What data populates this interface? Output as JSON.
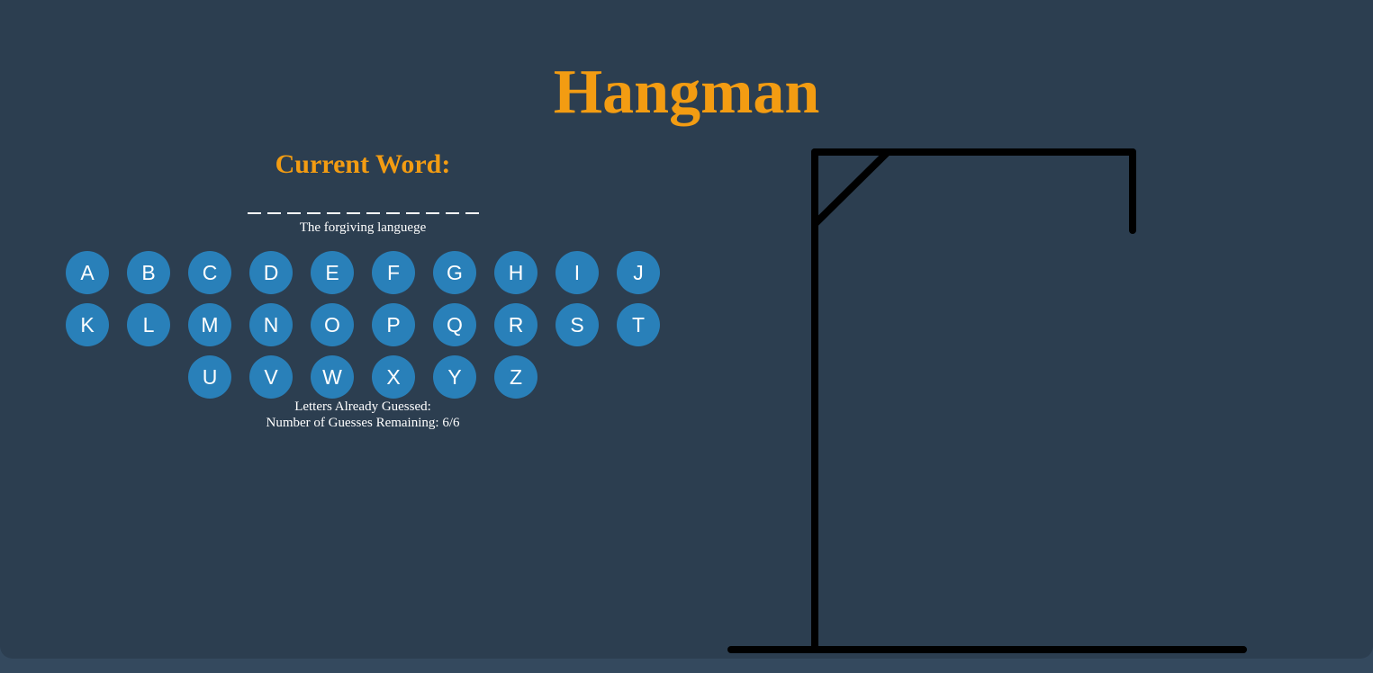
{
  "title": "Hangman",
  "current_word_label": "Current Word:",
  "word_blanks": [
    "_",
    "_",
    "_",
    "_",
    "_",
    "_",
    "_",
    "_",
    "_",
    "_",
    "_",
    "_"
  ],
  "hint": "The forgiving languege",
  "letters": [
    "A",
    "B",
    "C",
    "D",
    "E",
    "F",
    "G",
    "H",
    "I",
    "J",
    "K",
    "L",
    "M",
    "N",
    "O",
    "P",
    "Q",
    "R",
    "S",
    "T",
    "U",
    "V",
    "W",
    "X",
    "Y",
    "Z"
  ],
  "letters_guessed_label": "Letters Already Guessed:",
  "guesses_remaining_label": "Number of Guesses Remaining: 6/6",
  "colors": {
    "accent": "#f39c12",
    "background": "#2c3e50",
    "button": "#2980b9",
    "text": "#ffffff",
    "gallows": "#000000"
  }
}
